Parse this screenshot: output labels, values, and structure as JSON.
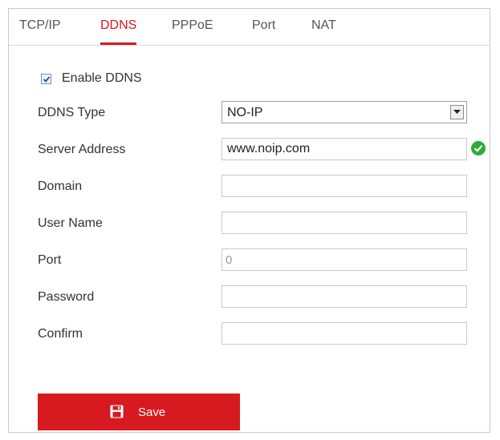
{
  "tabs": [
    {
      "label": "TCP/IP"
    },
    {
      "label": "DDNS",
      "active": true
    },
    {
      "label": "PPPoE"
    },
    {
      "label": "Port"
    },
    {
      "label": "NAT"
    }
  ],
  "enable_ddns": {
    "label": "Enable DDNS",
    "checked": true
  },
  "form": {
    "ddns_type": {
      "label": "DDNS Type",
      "value": "NO-IP"
    },
    "server_address": {
      "label": "Server Address",
      "value": "www.noip.com",
      "status_icon": "check-circle-icon"
    },
    "domain": {
      "label": "Domain",
      "value": ""
    },
    "user_name": {
      "label": "User Name",
      "value": ""
    },
    "port": {
      "label": "Port",
      "value": "0"
    },
    "password": {
      "label": "Password",
      "value": ""
    },
    "confirm": {
      "label": "Confirm",
      "value": ""
    }
  },
  "save_button": {
    "label": "Save",
    "icon": "floppy-disk-icon"
  },
  "colors": {
    "accent": "#d71920",
    "valid": "#2eaa3c"
  }
}
